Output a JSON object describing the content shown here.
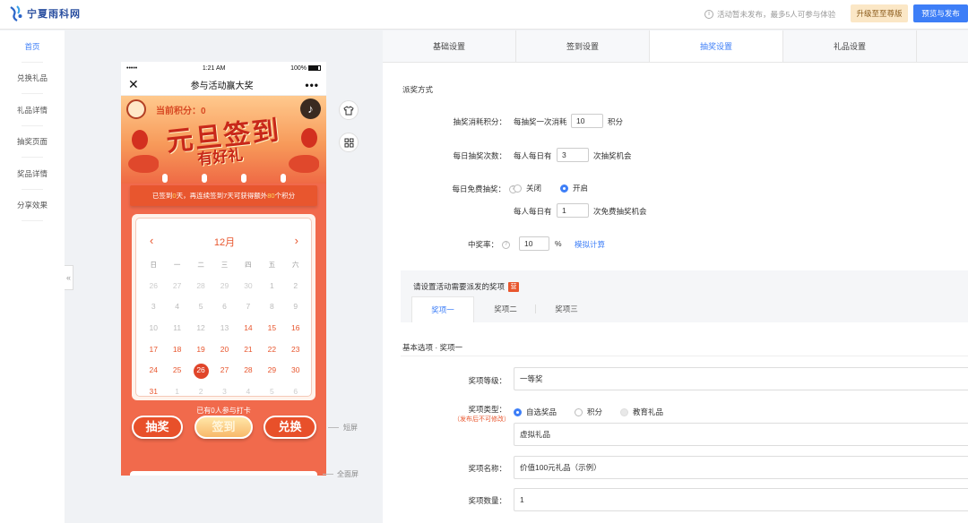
{
  "brand": {
    "name": "宁夏雨科网"
  },
  "topbar": {
    "notice": "活动暂未发布，最多5人可参与体验",
    "upgrade_label": "升级至至尊版",
    "publish_label": "预览与发布"
  },
  "sidebar": {
    "items": [
      {
        "label": "首页"
      },
      {
        "label": "兑换礼品"
      },
      {
        "label": "礼品详情"
      },
      {
        "label": "抽奖页面"
      },
      {
        "label": "奖品详情"
      },
      {
        "label": "分享效果"
      }
    ],
    "collapse_glyph": "«"
  },
  "phone": {
    "status": {
      "carrier": "•••••",
      "time": "1:21 AM",
      "battery": "100%"
    },
    "title": "参与活动赢大奖",
    "close_glyph": "✕",
    "more_glyph": "•••",
    "points_label": "当前积分：",
    "points_value": "0",
    "banner_title": "元旦签到",
    "banner_subtitle": "有好礼",
    "streak": {
      "prefix": "已签到",
      "days": "0",
      "middle": "天，再连续签到7天可获得额外",
      "bonus": "80",
      "suffix": "个积分"
    },
    "calendar": {
      "month": "12月",
      "weekdays": [
        "日",
        "一",
        "二",
        "三",
        "四",
        "五",
        "六"
      ],
      "days": [
        [
          "26",
          "27",
          "28",
          "29",
          "30",
          "1",
          "2"
        ],
        [
          "3",
          "4",
          "5",
          "6",
          "7",
          "8",
          "9"
        ],
        [
          "10",
          "11",
          "12",
          "13",
          "14",
          "15",
          "16"
        ],
        [
          "17",
          "18",
          "19",
          "20",
          "21",
          "22",
          "23"
        ],
        [
          "24",
          "25",
          "26",
          "27",
          "28",
          "29",
          "30"
        ],
        [
          "31",
          "1",
          "2",
          "3",
          "4",
          "5",
          "6"
        ]
      ]
    },
    "joined": "已有0人参与打卡",
    "buttons": {
      "draw": "抽奖",
      "checkin": "签到",
      "redeem": "兑换"
    }
  },
  "markers": {
    "short_screen": "短屏",
    "full_screen": "全面屏"
  },
  "tabs": [
    {
      "label": "基础设置"
    },
    {
      "label": "签到设置"
    },
    {
      "label": "抽奖设置"
    },
    {
      "label": "礼品设置"
    }
  ],
  "lottery": {
    "section_title": "派奖方式",
    "cost": {
      "label": "抽奖消耗积分：",
      "prefix": "每抽奖一次消耗",
      "value": "10",
      "suffix": "积分"
    },
    "daily": {
      "label": "每日抽奖次数：",
      "prefix": "每人每日有",
      "value": "3",
      "suffix": "次抽奖机会"
    },
    "free": {
      "label": "每日免费抽奖：",
      "off_label": "关闭",
      "on_label": "开启",
      "selected": "开启",
      "prefix": "每人每日有",
      "value": "1",
      "suffix": "次免费抽奖机会"
    },
    "rate": {
      "label": "中奖率：",
      "value": "10",
      "unit": "%",
      "link": "模拟计算"
    }
  },
  "prizes": {
    "header": "请设置活动需要派发的奖项",
    "badge": "营",
    "tabs": [
      {
        "label": "奖项一"
      },
      {
        "label": "奖项二"
      },
      {
        "label": "奖项三"
      }
    ],
    "basic_title": "基本选项 · 奖项一",
    "level": {
      "label": "奖项等级：",
      "value": "一等奖"
    },
    "type": {
      "label": "奖项类型：",
      "note": "（发布后不可修改）",
      "options": [
        {
          "label": "自选奖品"
        },
        {
          "label": "积分"
        },
        {
          "label": "教育礼品"
        }
      ],
      "selected": "自选奖品",
      "value": "虚拟礼品"
    },
    "name": {
      "label": "奖项名称：",
      "value": "价值100元礼品（示例）"
    },
    "quantity": {
      "label": "奖项数量：",
      "value": "1"
    }
  }
}
